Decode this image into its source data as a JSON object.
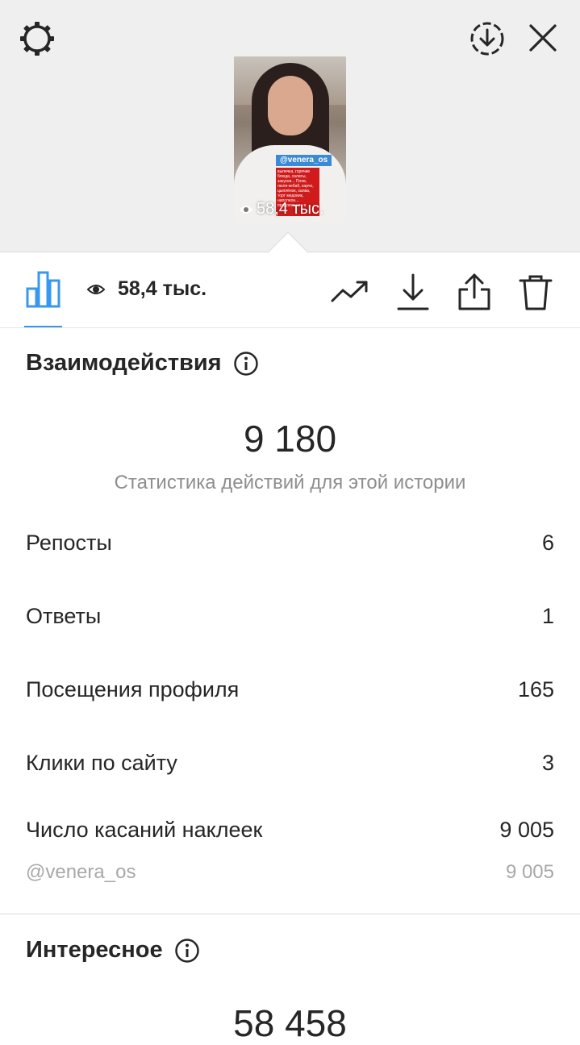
{
  "preview": {
    "sticker_handle": "@venera_os",
    "sticker_text": "выпечка, горячие блюда, салаты, закуски... Плов, люля-кебаб, харчо, цыплёнок, халва, торт медовик, наполеон... продолжение в",
    "views": "58,4 тыс."
  },
  "icons": {
    "settings": "gear-icon",
    "download_circle": "download-circle-icon",
    "close": "close-icon",
    "stats_tab": "bar-chart-icon",
    "eye": "eye-icon",
    "promote": "trend-up-icon",
    "download": "download-icon",
    "share": "share-icon",
    "delete": "trash-icon",
    "info": "info-icon"
  },
  "toolbar": {
    "views": "58,4 тыс."
  },
  "interactions": {
    "title": "Взаимодействия",
    "total": "9 180",
    "subtitle": "Статистика действий для этой истории",
    "rows": [
      {
        "label": "Репосты",
        "value": "6"
      },
      {
        "label": "Ответы",
        "value": "1"
      },
      {
        "label": "Посещения профиля",
        "value": "165"
      },
      {
        "label": "Клики по сайту",
        "value": "3"
      },
      {
        "label": "Число касаний наклеек",
        "value": "9 005"
      }
    ],
    "sub_row": {
      "label": "@venera_os",
      "value": "9 005"
    }
  },
  "discovery": {
    "title": "Интересное",
    "total": "58 458"
  },
  "colors": {
    "accent": "#3897f0",
    "text": "#262626",
    "muted": "#8e8e8e",
    "sticker_blue": "#3a8ad6",
    "sticker_red": "#cf1b1b"
  }
}
